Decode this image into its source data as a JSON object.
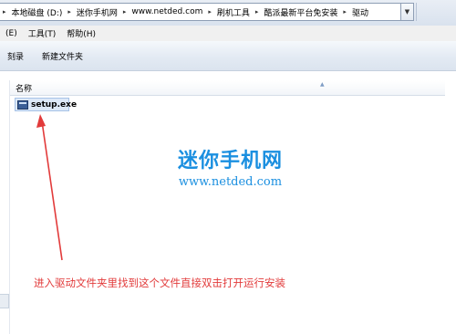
{
  "address_bar": {
    "crumbs": [
      {
        "label": "本地磁盘 (D:)"
      },
      {
        "label": "迷你手机网"
      },
      {
        "label": "www.netded.com"
      },
      {
        "label": "刷机工具"
      },
      {
        "label": "酷派最新平台免安装"
      },
      {
        "label": "驱动"
      }
    ],
    "chevron_icon": "chevron-down-icon"
  },
  "menu": {
    "items": [
      {
        "label": "(E)"
      },
      {
        "label": "工具(T)"
      },
      {
        "label": "帮助(H)"
      }
    ]
  },
  "toolbar": {
    "burn_label": "刻录",
    "new_folder_label": "新建文件夹"
  },
  "file_list": {
    "column_name": "名称",
    "sort_icon": "sort-ascending-icon",
    "files": [
      {
        "name": "setup.exe",
        "icon": "executable-file-icon",
        "selected": true
      }
    ]
  },
  "watermark": {
    "title": "迷你手机网",
    "url": "www.netded.com",
    "color": "#1a8fe0"
  },
  "annotation": {
    "text": "进入驱动文件夹里找到这个文件直接双击打开运行安装",
    "color": "#e23b3b"
  }
}
